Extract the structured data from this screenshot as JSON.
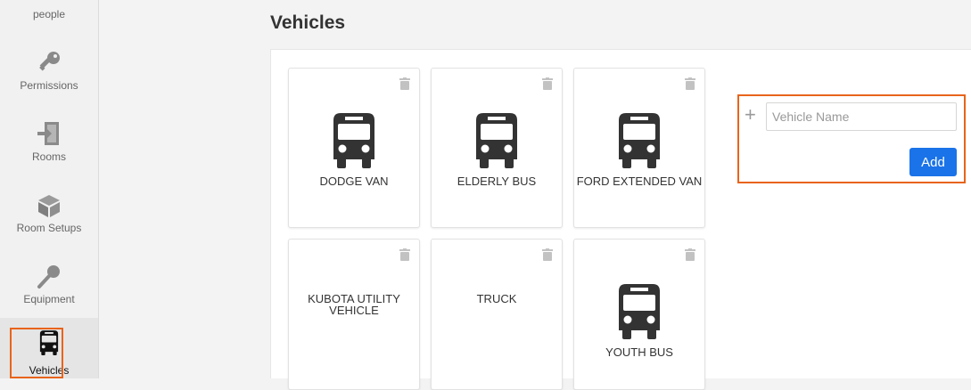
{
  "sidebar": {
    "items": [
      {
        "label": "people",
        "icon": "people-icon"
      },
      {
        "label": "Permissions",
        "icon": "key-icon"
      },
      {
        "label": "Rooms",
        "icon": "door-icon"
      },
      {
        "label": "Room Setups",
        "icon": "cube-icon"
      },
      {
        "label": "Equipment",
        "icon": "microphone-icon"
      },
      {
        "label": "Vehicles",
        "icon": "bus-icon",
        "active": true
      }
    ]
  },
  "page": {
    "title": "Vehicles"
  },
  "vehicles": [
    {
      "name": "DODGE VAN",
      "has_icon": true
    },
    {
      "name": "ELDERLY BUS",
      "has_icon": true
    },
    {
      "name": "FORD EXTENDED VAN",
      "has_icon": true
    },
    {
      "name": "KUBOTA UTILITY VEHICLE",
      "has_icon": false
    },
    {
      "name": "TRUCK",
      "has_icon": false
    },
    {
      "name": "YOUTH BUS",
      "has_icon": true
    }
  ],
  "add_form": {
    "plus_symbol": "+",
    "placeholder": "Vehicle Name",
    "value": "",
    "button_label": "Add"
  },
  "colors": {
    "accent_outline": "#e8641b",
    "primary_button": "#1a73e8",
    "icon_dark": "#333333",
    "icon_gray": "#8a8a8a"
  }
}
